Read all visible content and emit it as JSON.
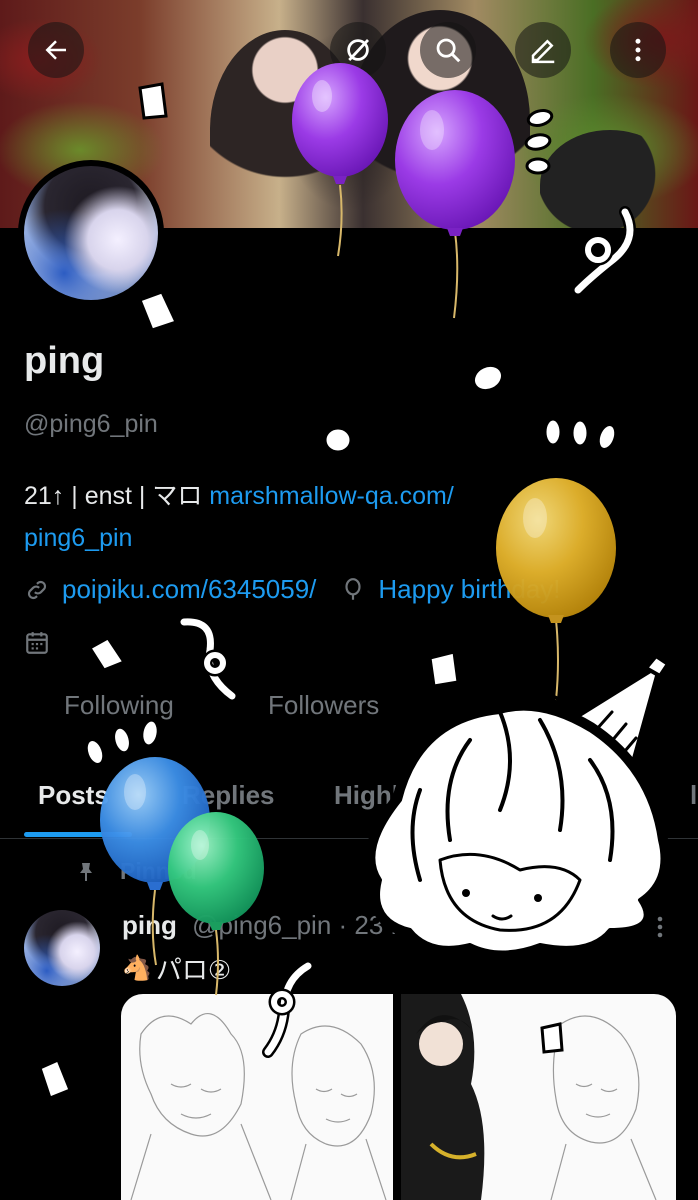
{
  "profile": {
    "name": "ping",
    "handle": "@ping6_pin",
    "bio_text": "21↑ | enst | マロ ",
    "bio_link_line1": "marshmallow-qa.com/",
    "bio_link_line2": "ping6_pin",
    "website": "poipiku.com/6345059/",
    "birthday": "Happy birthday!"
  },
  "stats": {
    "following_label": "Following",
    "followers_label": "Followers"
  },
  "tabs": [
    "Posts",
    "Replies",
    "Highl",
    "l"
  ],
  "post": {
    "pinned_label": "Pinned",
    "author_name": "ping",
    "author_meta": "@ping6_pin · 23 Mi",
    "text": "パロ②"
  },
  "icons": {
    "back": "arrow-left-icon",
    "grok": "grok-icon",
    "search": "search-icon",
    "edit": "edit-icon",
    "more": "more-vertical-icon",
    "link": "link-icon",
    "birthday": "balloon-icon",
    "calendar": "calendar-icon",
    "pin": "pin-icon",
    "horse": "horse-emoji-icon"
  },
  "colors": {
    "accent": "#1d9bf0",
    "muted": "#71767b",
    "text": "#e7e9ea",
    "background": "#000000"
  }
}
